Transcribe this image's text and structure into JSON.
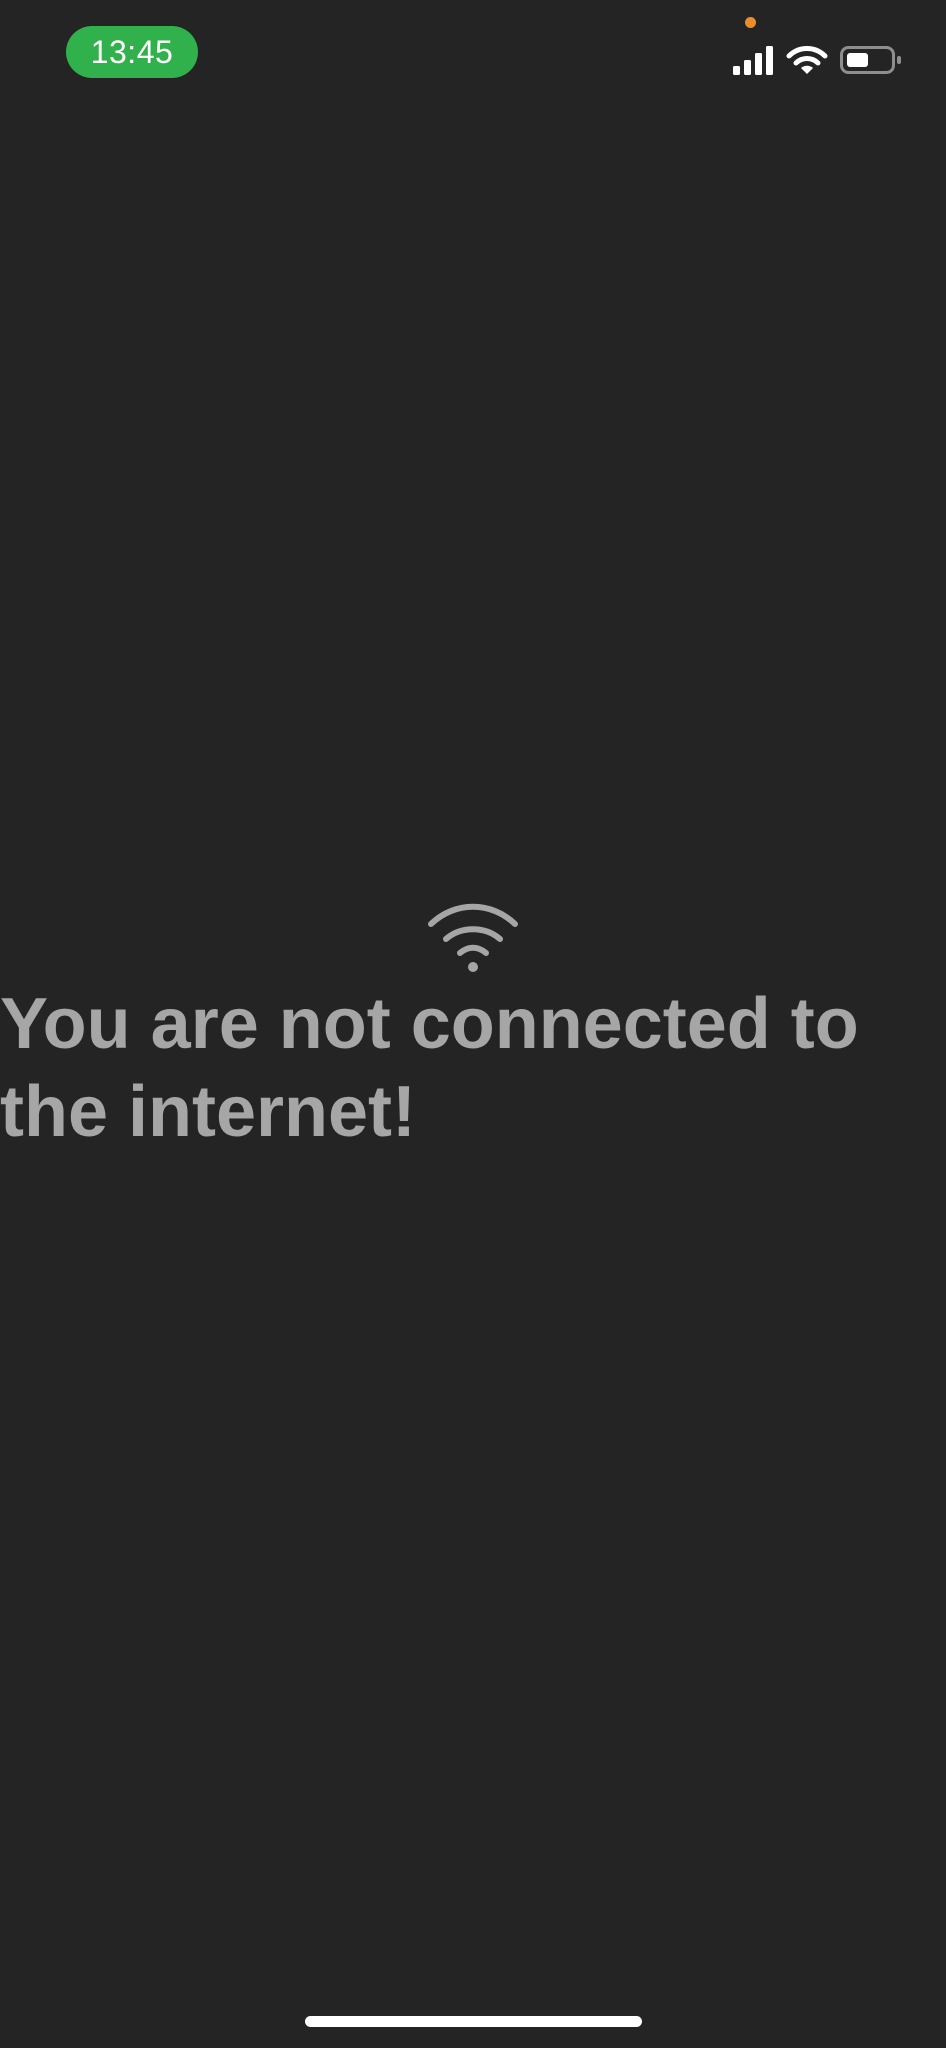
{
  "status_bar": {
    "time": "13:45",
    "time_pill_color": "#30b14c",
    "privacy_indicator_color": "#ee8d28",
    "icons": [
      "cellular-signal-icon",
      "wifi-icon",
      "battery-icon"
    ],
    "battery_level": 0.5
  },
  "main": {
    "icon": "wifi-icon",
    "message": "You are not connected to the internet!",
    "text_color": "#a6a6a6"
  },
  "theme": {
    "background": "#242424"
  }
}
